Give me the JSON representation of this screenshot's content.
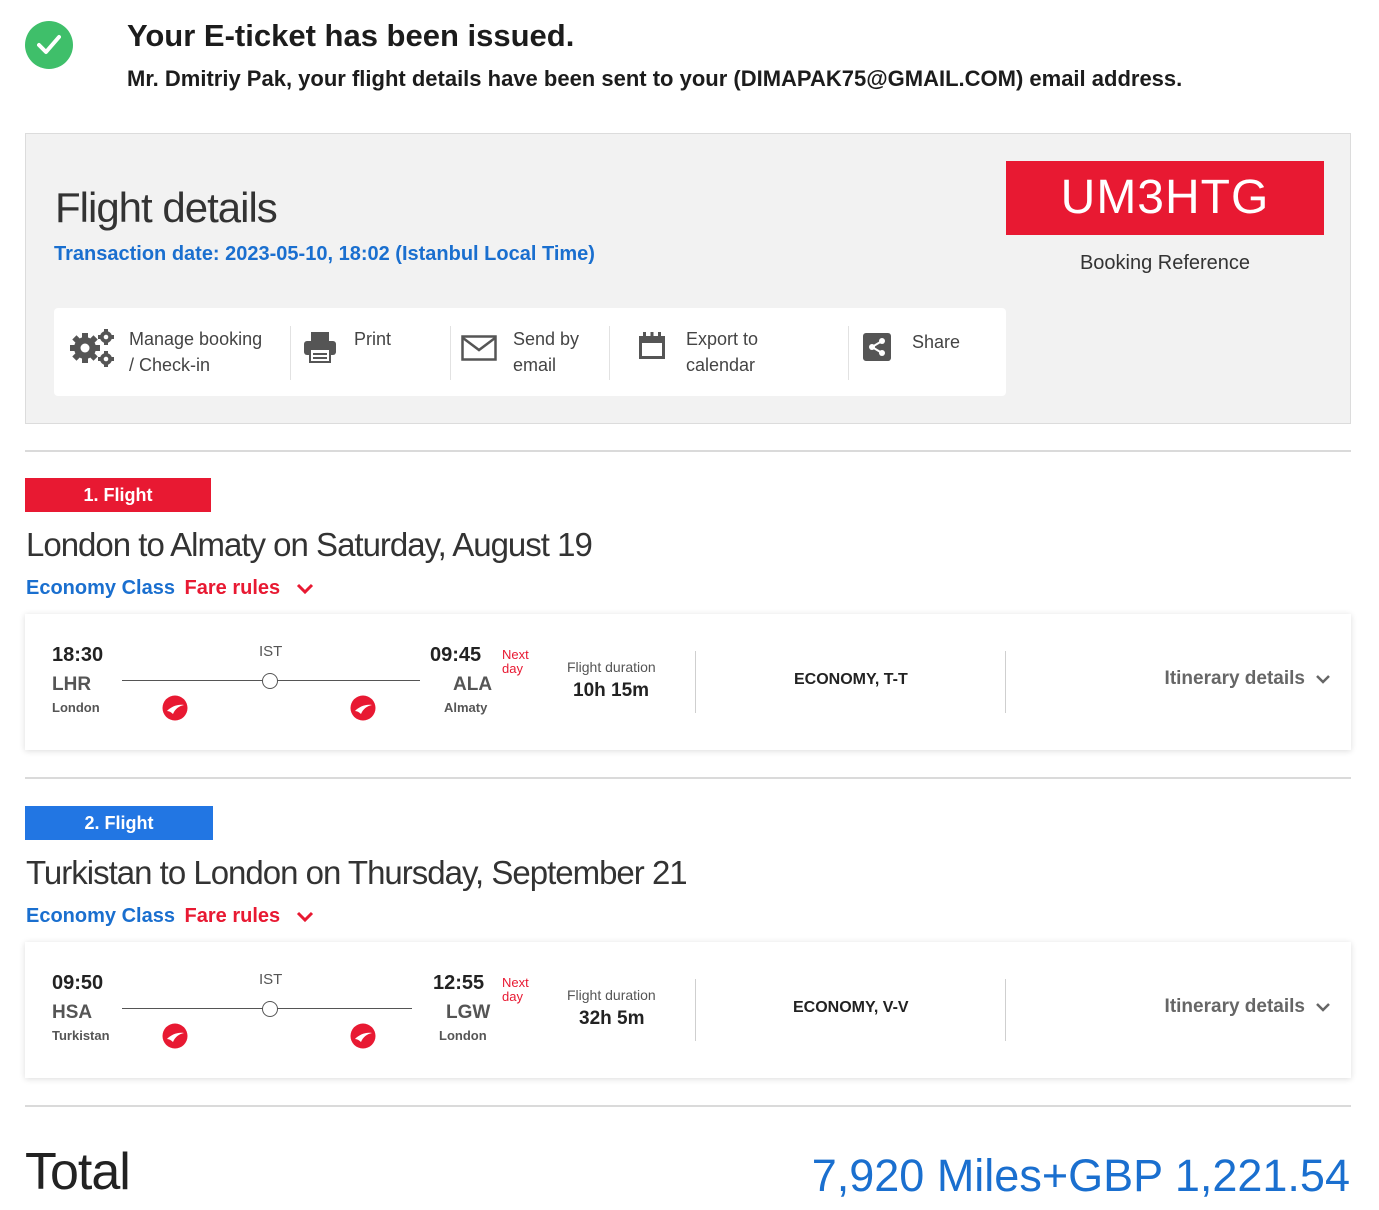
{
  "header": {
    "title": "Your E-ticket has been issued.",
    "subtitle": "Mr. Dmitriy Pak, your flight details have been sent to your (DIMAPAK75@GMAIL.COM) email address."
  },
  "details": {
    "title": "Flight details",
    "transaction": "Transaction date: 2023-05-10, 18:02 (Istanbul Local Time)",
    "pnr": "UM3HTG",
    "pnr_label": "Booking Reference",
    "actions": {
      "manage_1": "Manage booking",
      "manage_2": "/ Check-in",
      "print": "Print",
      "email_1": "Send by",
      "email_2": "email",
      "calendar_1": "Export to",
      "calendar_2": "calendar",
      "share": "Share"
    }
  },
  "flights": [
    {
      "tag": "1. Flight",
      "route": "London to Almaty on Saturday, August 19",
      "class": "Economy Class",
      "fare_rules": "Fare rules",
      "dep_time": "18:30",
      "dep_code": "LHR",
      "dep_city": "London",
      "via": "IST",
      "arr_time": "09:45",
      "arr_code": "ALA",
      "arr_city": "Almaty",
      "next_1": "Next",
      "next_2": "day",
      "duration_label": "Flight duration",
      "duration": "10h 15m",
      "cabin": "ECONOMY, T-T",
      "itinerary": "Itinerary details"
    },
    {
      "tag": "2. Flight",
      "route": "Turkistan to London on Thursday, September 21",
      "class": "Economy Class",
      "fare_rules": "Fare rules",
      "dep_time": "09:50",
      "dep_code": "HSA",
      "dep_city": "Turkistan",
      "via": "IST",
      "arr_time": "12:55",
      "arr_code": "LGW",
      "arr_city": "London",
      "next_1": "Next",
      "next_2": "day",
      "duration_label": "Flight duration",
      "duration": "32h 5m",
      "cabin": "ECONOMY, V-V",
      "itinerary": "Itinerary details"
    }
  ],
  "total": {
    "label": "Total",
    "value": "7,920 Miles+GBP 1,221.54"
  },
  "colors": {
    "brand_red": "#e81932",
    "link_blue": "#1a6fcf",
    "success_green": "#3fbf6a"
  },
  "icons": [
    "check-icon",
    "gears-icon",
    "printer-icon",
    "envelope-icon",
    "calendar-icon",
    "share-icon",
    "airline-logo-icon",
    "chevron-down-icon"
  ]
}
